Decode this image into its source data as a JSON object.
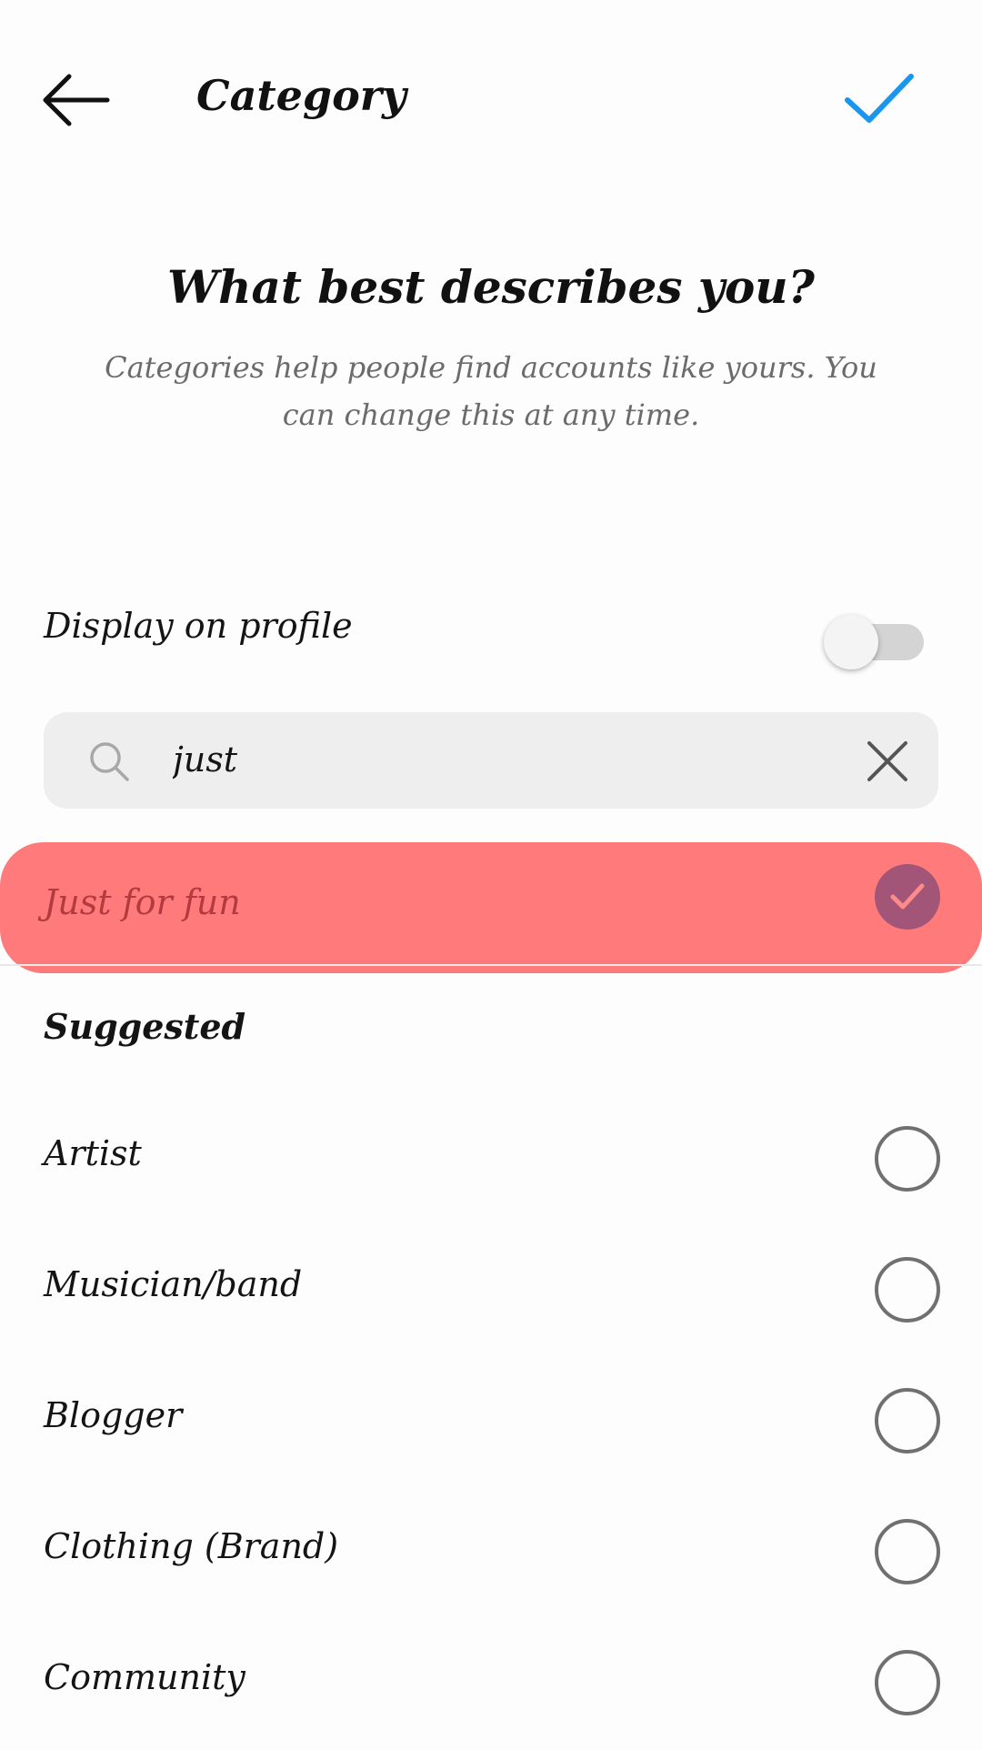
{
  "header": {
    "title": "Category",
    "back_icon": "back-arrow-icon",
    "done_icon": "checkmark-icon",
    "done_color": "#1a97ec"
  },
  "intro": {
    "question": "What best describes you?",
    "subtitle": "Categories help people find accounts like yours. You can change this at any time."
  },
  "display_toggle": {
    "label": "Display on profile",
    "enabled": false
  },
  "search": {
    "value": "just",
    "icon": "search-icon",
    "clear_icon": "close-icon"
  },
  "selected_result": {
    "label": "Just for fun",
    "selected": true,
    "highlight_color": "#ff7b7b"
  },
  "suggested": {
    "title": "Suggested",
    "options": [
      {
        "label": "Artist",
        "selected": false
      },
      {
        "label": "Musician/band",
        "selected": false
      },
      {
        "label": "Blogger",
        "selected": false
      },
      {
        "label": "Clothing (Brand)",
        "selected": false
      },
      {
        "label": "Community",
        "selected": false
      }
    ]
  }
}
